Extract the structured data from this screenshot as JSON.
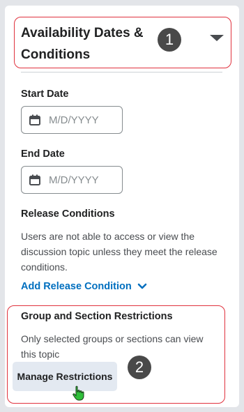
{
  "section": {
    "title": "Availability Dates & Conditions",
    "collapse_icon": "caret-down-icon"
  },
  "callouts": {
    "first": "1",
    "second": "2"
  },
  "start_date": {
    "label": "Start Date",
    "placeholder": "M/D/YYYY",
    "icon": "calendar-icon"
  },
  "end_date": {
    "label": "End Date",
    "placeholder": "M/D/YYYY",
    "icon": "calendar-icon"
  },
  "release_conditions": {
    "label": "Release Conditions",
    "description": "Users are not able to access or view the discussion topic unless they meet the release conditions.",
    "add_link": "Add Release Condition",
    "add_link_icon": "chevron-down-icon"
  },
  "restrictions": {
    "label": "Group and Section Restrictions",
    "description": "Only selected groups or sections can view this topic",
    "manage_button": "Manage Restrictions"
  },
  "colors": {
    "link": "#006fbf",
    "callout_border": "#e0313d",
    "cursor": "#2fbf3a"
  }
}
